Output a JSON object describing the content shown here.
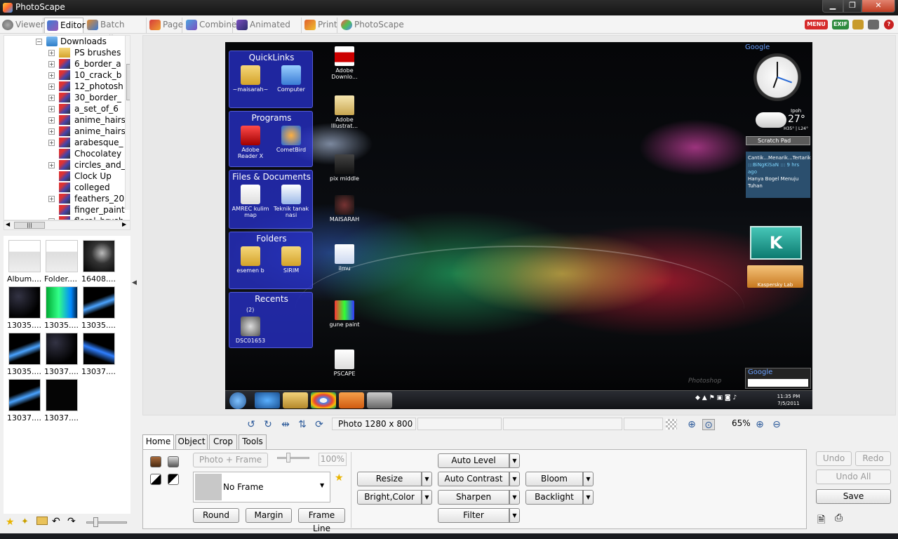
{
  "window": {
    "title": "PhotoScape",
    "min": "▁",
    "max": "❐",
    "close": "✕"
  },
  "tabs": [
    {
      "label": "Viewer"
    },
    {
      "label": "Editor"
    },
    {
      "label": "Batch Editor"
    },
    {
      "label": "Page"
    },
    {
      "label": "Combine"
    },
    {
      "label": "Animated GIF"
    },
    {
      "label": "Print"
    },
    {
      "label": "PhotoScape"
    }
  ],
  "top_right": {
    "menu": "MENU",
    "exif": "EXIF",
    "help": "?"
  },
  "colors": {
    "menu_red": "#d62b2b",
    "exif_green": "#2e8b3e",
    "title_bar": "#1d1d1d"
  },
  "tree": {
    "root": "Downloads",
    "items": [
      {
        "label": "PS brushes",
        "folder": true,
        "exp": "+"
      },
      {
        "label": "6_border_a",
        "exp": "+"
      },
      {
        "label": "10_crack_b",
        "exp": "+"
      },
      {
        "label": "12_photosh",
        "exp": "+"
      },
      {
        "label": "30_border_",
        "exp": "+"
      },
      {
        "label": "a_set_of_6",
        "exp": "+"
      },
      {
        "label": "anime_hairs",
        "exp": "+"
      },
      {
        "label": "anime_hairs",
        "exp": "+"
      },
      {
        "label": "arabesque_",
        "exp": "+"
      },
      {
        "label": "Chocolatey",
        "exp": ""
      },
      {
        "label": "circles_and_",
        "exp": "+"
      },
      {
        "label": "Clock Up",
        "exp": ""
      },
      {
        "label": "colleged",
        "exp": ""
      },
      {
        "label": "feathers_20",
        "exp": "+"
      },
      {
        "label": "finger_paint",
        "exp": ""
      },
      {
        "label": "floral_brush",
        "exp": "+"
      }
    ],
    "hscroll_thumb": "|||"
  },
  "thumbnails": [
    {
      "caption": "Album....",
      "kind": "boyfriend"
    },
    {
      "caption": "Folder....",
      "kind": "boyfriend"
    },
    {
      "caption": "16408....",
      "kind": "face"
    },
    {
      "caption": "13035....",
      "kind": "dark"
    },
    {
      "caption": "13035....",
      "kind": "green"
    },
    {
      "caption": "13035....",
      "kind": "blue"
    },
    {
      "caption": "13035....",
      "kind": "blue"
    },
    {
      "caption": "13037....",
      "kind": "dark"
    },
    {
      "caption": "13037....",
      "kind": "bluewave"
    },
    {
      "caption": "13037....",
      "kind": "blue"
    },
    {
      "caption": "13037....",
      "kind": "black"
    }
  ],
  "photo": {
    "quicklinks": {
      "sections": [
        {
          "title": "QuickLinks",
          "items": [
            "~maisarah~",
            "Computer"
          ]
        },
        {
          "title": "Programs",
          "items": [
            "Adobe Reader X",
            "CometBird"
          ]
        },
        {
          "title": "Files & Documents",
          "items": [
            "AMREC kulim map",
            "Teknik tanak nasi"
          ]
        },
        {
          "title": "Folders",
          "items": [
            "esemen b",
            "SIRIM"
          ]
        },
        {
          "title": "Recents",
          "items": [
            "DSC01653"
          ],
          "count": "(2)"
        }
      ]
    },
    "desktop_icons": [
      "Adobe Downlo...",
      "Adobe Illustrat...",
      "pix middle",
      "MAISARAH",
      "ilmu",
      "gune paint",
      "PSCAPE"
    ],
    "google": "Google",
    "weather": {
      "location": "Ipoh",
      "temp": "27°",
      "hilo": "H35° | L24°"
    },
    "scratch_pad": "Scratch Pad",
    "feed": {
      "line1": "Cantik...Menarik...Tertarik",
      "author": ":::BiNgKiSaN :::",
      "ago": "9 hrs ago",
      "line2": "Hanya Bogel Menuju Tuhan"
    },
    "kaspersky": {
      "logo": "K",
      "label": "Kaspersky Lab"
    },
    "google_search": "Google",
    "clock_time": "11:35 PM",
    "clock_date": "7/5/2011",
    "signature": "Photoshop"
  },
  "status": {
    "info": "Photo 1280 x 800",
    "zoom": "65%"
  },
  "bottom_tabs": [
    "Home",
    "Object",
    "Crop",
    "Tools"
  ],
  "home": {
    "photo_frame": "Photo + Frame",
    "percent": "100%",
    "frame": "No Frame",
    "round": "Round",
    "margin": "Margin",
    "frame_line": "Frame Line",
    "resize": "Resize",
    "bright_color": "Bright,Color",
    "auto_level": "Auto Level",
    "auto_contrast": "Auto Contrast",
    "sharpen": "Sharpen",
    "filter": "Filter",
    "bloom": "Bloom",
    "backlight": "Backlight"
  },
  "actions": {
    "undo": "Undo",
    "redo": "Redo",
    "undo_all": "Undo All",
    "save": "Save"
  }
}
